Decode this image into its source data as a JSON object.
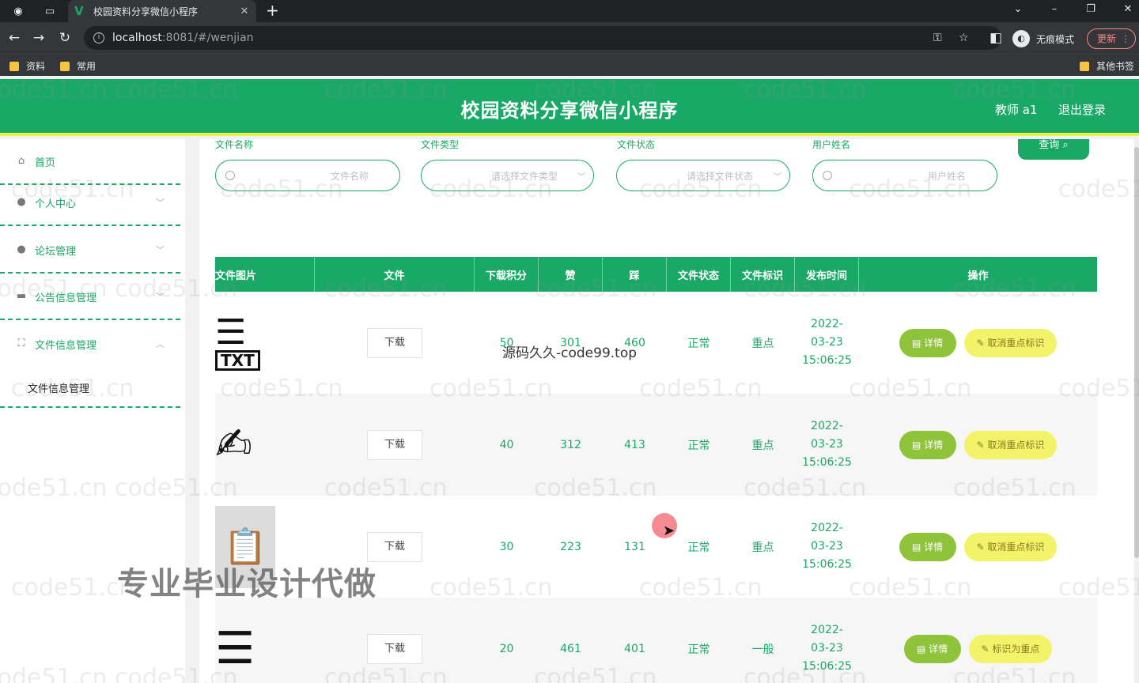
{
  "browser": {
    "tab_title": "校园资料分享微信小程序",
    "url_host": "localhost",
    "url_rest": ":8081/#/wenjian",
    "incognito_label": "无痕模式",
    "update_label": "更新",
    "bookmarks": [
      "资料",
      "常用"
    ],
    "other_bookmarks": "其他书签"
  },
  "header": {
    "title": "校园资料分享微信小程序",
    "user": "教师 a1",
    "logout": "退出登录",
    "accent": "#1aa867"
  },
  "sidebar": {
    "items": [
      {
        "label": "首页",
        "icon": "home-icon"
      },
      {
        "label": "个人中心",
        "icon": "user-icon"
      },
      {
        "label": "论坛管理",
        "icon": "user-icon"
      },
      {
        "label": "公告信息管理",
        "icon": "briefcase-icon"
      },
      {
        "label": "文件信息管理",
        "icon": "expand-icon"
      }
    ],
    "sub_item": "文件信息管理"
  },
  "search": {
    "fields": [
      {
        "label": "文件名称",
        "placeholder": "文件名称"
      },
      {
        "label": "文件类型",
        "placeholder": "请选择文件类型"
      },
      {
        "label": "文件状态",
        "placeholder": "请选择文件状态"
      },
      {
        "label": "用户姓名",
        "placeholder": "用户姓名"
      }
    ],
    "button": "查询"
  },
  "table": {
    "headers": [
      "文件图片",
      "文件",
      "下载积分",
      "赞",
      "踩",
      "文件状态",
      "文件标识",
      "发布时间",
      "操作"
    ],
    "rows": [
      {
        "download": "下载",
        "points": "50",
        "likes": "301",
        "dislikes": "460",
        "status": "正常",
        "mark": "重点",
        "time": "2022-03-23 15:06:25",
        "detail": "详情",
        "action": "取消重点标识"
      },
      {
        "download": "下载",
        "points": "40",
        "likes": "312",
        "dislikes": "413",
        "status": "正常",
        "mark": "重点",
        "time": "2022-03-23 15:06:25",
        "detail": "详情",
        "action": "取消重点标识"
      },
      {
        "download": "下载",
        "points": "30",
        "likes": "223",
        "dislikes": "131",
        "status": "正常",
        "mark": "重点",
        "time": "2022-03-23 15:06:25",
        "detail": "详情",
        "action": "取消重点标识"
      },
      {
        "download": "下载",
        "points": "20",
        "likes": "461",
        "dislikes": "401",
        "status": "正常",
        "mark": "一般",
        "time": "2022-03-23 15:06:25",
        "detail": "详情",
        "action": "标识为重点"
      }
    ]
  },
  "overlays": {
    "watermark": "code51.cn",
    "video_watermark": "源码久久-code99.top",
    "ad_text": "专业毕业设计代做",
    "txt_badge": "TXT"
  }
}
